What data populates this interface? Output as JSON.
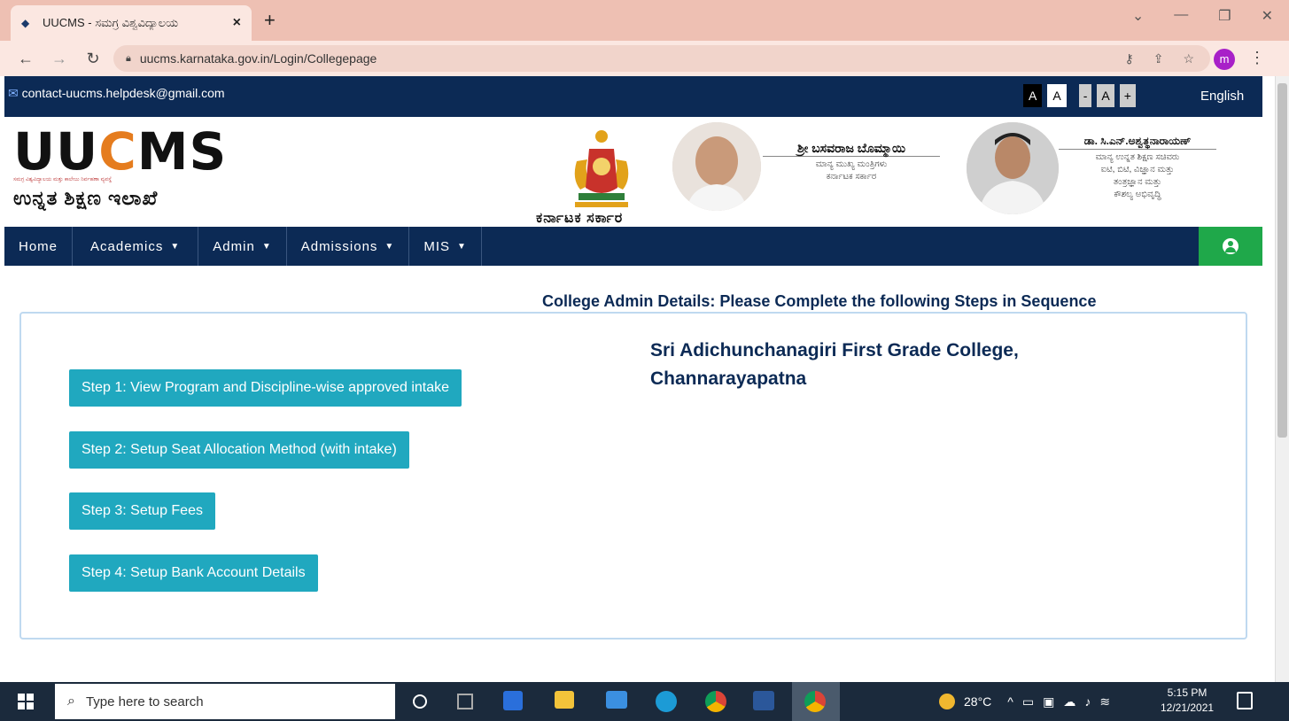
{
  "browser": {
    "tab_title": "UUCMS - ಸಮಗ್ರ ವಿಶ್ವವಿದ್ಯಾಲಯ",
    "close": "×",
    "new_tab": "+",
    "url": "uucms.karnataka.gov.in/Login/Collegepage",
    "profile_initial": "m"
  },
  "infobar": {
    "email": "contact-uucms.helpdesk@gmail.com",
    "font_buttons": [
      "A",
      "A",
      "-",
      "A",
      "+"
    ],
    "language": "English"
  },
  "header": {
    "logo_text": "UUCMS",
    "logo_subtitle": "ಸಮಗ್ರ ವಿಶ್ವವಿದ್ಯಾಲಯ ಮತ್ತು ಕಾಲೇಜು ನಿರ್ವಹಣಾ ವ್ಯವಸ್ಥೆ",
    "department": "ಉನ್ನತ ಶಿಕ್ಷಣ ಇಲಾಖೆ",
    "emblem_caption": "ಕರ್ನಾಟಕ ಸರ್ಕಾರ",
    "person1": {
      "name": "ಶ್ರೀ ಬಸವರಾಜ ಬೊಮ್ಮಾಯಿ",
      "line1": "ಮಾನ್ಯ ಮುಖ್ಯ ಮಂತ್ರಿಗಳು",
      "line2": "ಕರ್ನಾಟಕ ಸರ್ಕಾರ"
    },
    "person2": {
      "name": "ಡಾ. ಸಿ.ಎನ್.ಅಶ್ವತ್ಥನಾರಾಯಣ್",
      "line1": "ಮಾನ್ಯ ಉನ್ನತ ಶಿಕ್ಷಣ ಸಚಿವರು",
      "line2": "ಐಟಿ, ಬಿಟಿ, ವಿಜ್ಞಾನ ಮತ್ತು",
      "line3": "ತಂತ್ರಜ್ಞಾನ ಮತ್ತು",
      "line4": "ಕೌಶಲ್ಯ ಅಭಿವೃದ್ಧಿ"
    }
  },
  "nav": {
    "items": [
      {
        "label": "Home",
        "dropdown": false
      },
      {
        "label": "Academics",
        "dropdown": true
      },
      {
        "label": "Admin",
        "dropdown": true
      },
      {
        "label": "Admissions",
        "dropdown": true
      },
      {
        "label": "MIS",
        "dropdown": true
      }
    ],
    "chevron": "⌄"
  },
  "main": {
    "title": "College Admin Details: Please Complete the following Steps in Sequence",
    "college_name": "Sri Adichunchanagiri First Grade College, Channarayapatna",
    "steps": [
      "Step 1: View Program and Discipline-wise approved intake",
      "Step 2: Setup Seat Allocation Method (with intake)",
      "Step 3: Setup Fees",
      "Step 4: Setup Bank Account Details"
    ]
  },
  "taskbar": {
    "search_placeholder": "Type here to search",
    "temperature": "28°C",
    "time": "5:15 PM",
    "date": "12/21/2021"
  },
  "colors": {
    "navy": "#0c2a55",
    "step_button": "#20a8bf",
    "user_green": "#1fa84a",
    "tab_strip": "#eec0b3"
  }
}
